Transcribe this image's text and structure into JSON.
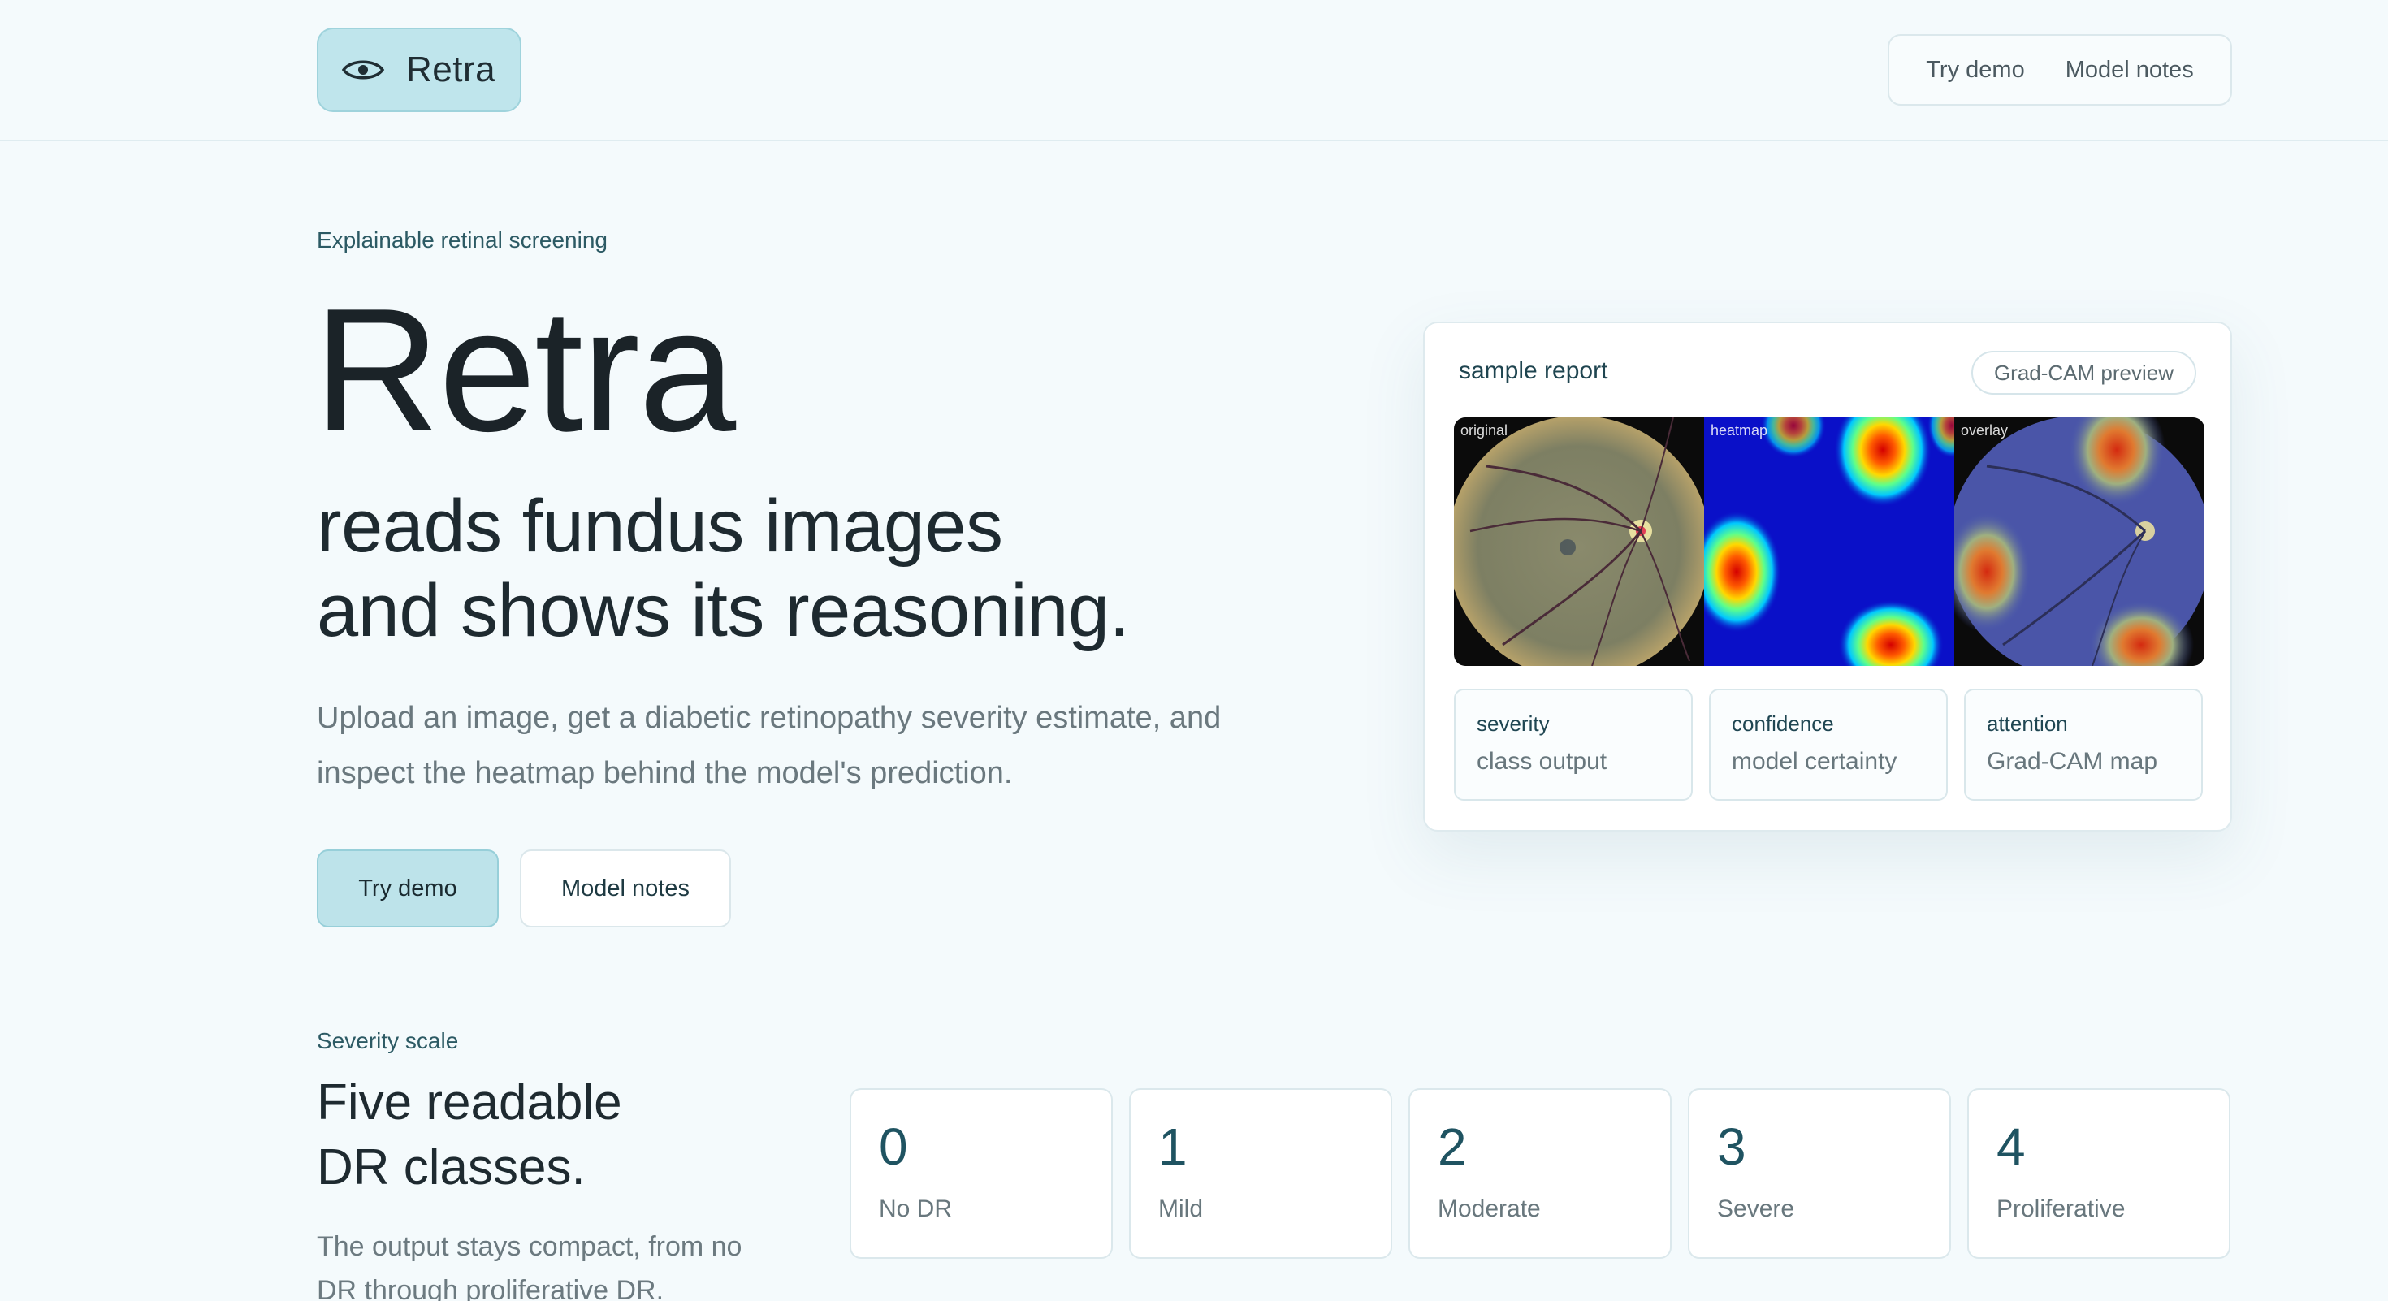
{
  "header": {
    "brand_name": "Retra",
    "nav": [
      "Try demo",
      "Model notes"
    ]
  },
  "hero": {
    "eyebrow": "Explainable retinal screening",
    "title": "Retra",
    "subtitle_line1": "reads fundus images",
    "subtitle_line2": "and shows its reasoning.",
    "description": "Upload an image, get a diabetic retinopathy severity estimate, and inspect the heatmap behind the model's prediction.",
    "primary_button": "Try demo",
    "secondary_button": "Model notes"
  },
  "report": {
    "title": "sample report",
    "badge": "Grad-CAM preview",
    "panels": [
      "original",
      "heatmap",
      "overlay"
    ],
    "metrics": [
      {
        "key": "severity",
        "value": "class output"
      },
      {
        "key": "confidence",
        "value": "model certainty"
      },
      {
        "key": "attention",
        "value": "Grad-CAM map"
      }
    ]
  },
  "severity": {
    "eyebrow": "Severity scale",
    "title_line1": "Five readable",
    "title_line2": "DR classes.",
    "description": "The output stays compact, from no DR through proliferative DR.",
    "classes": [
      {
        "num": "0",
        "name": "No DR"
      },
      {
        "num": "1",
        "name": "Mild"
      },
      {
        "num": "2",
        "name": "Moderate"
      },
      {
        "num": "3",
        "name": "Severe"
      },
      {
        "num": "4",
        "name": "Proliferative"
      }
    ]
  },
  "colors": {
    "accent": "#bde3ea",
    "accent_border": "#97cfd9",
    "background": "#f4fafc",
    "heatmap_base": "#0a10c8"
  },
  "icons": {
    "brand": "eye-icon"
  }
}
